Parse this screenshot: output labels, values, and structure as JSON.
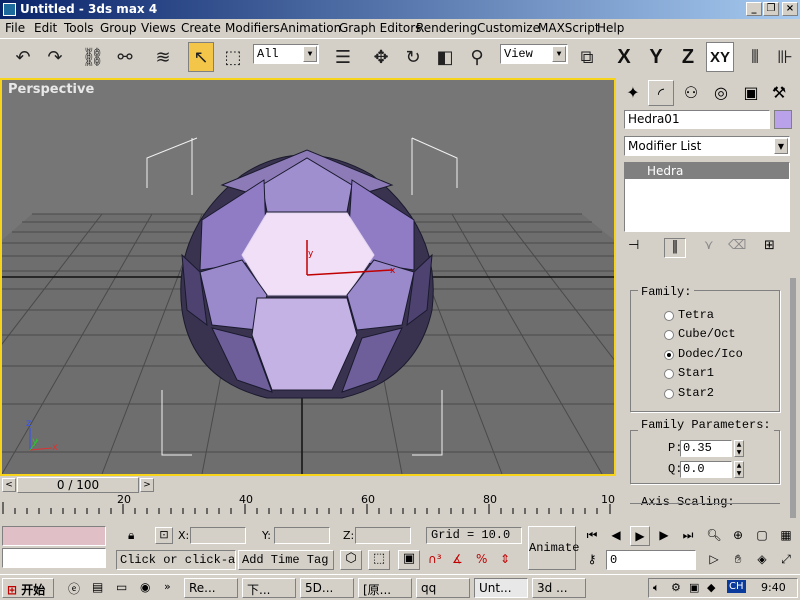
{
  "window": {
    "title": "Untitled - 3ds max 4"
  },
  "menu": [
    "File",
    "Edit",
    "Tools",
    "Group",
    "Views",
    "Create",
    "Modifiers",
    "Animation",
    "Graph Editors",
    "Rendering",
    "Customize",
    "MAXScript",
    "Help"
  ],
  "toolbar": {
    "selection_filter": "All",
    "ref_coord": "View",
    "axis_x": "X",
    "axis_y": "Y",
    "axis_z": "Z",
    "axis_xy": "XY"
  },
  "viewport": {
    "label": "Perspective"
  },
  "time_slider": {
    "value": "0 / 100"
  },
  "timeline": {
    "ticks": [
      "20",
      "40",
      "60",
      "80",
      "10"
    ]
  },
  "command_panel": {
    "object_name": "Hedra01",
    "object_color": "#b9a2ea",
    "modifier_list": "Modifier List",
    "stack_item": "Hedra",
    "family_group": "Family:",
    "families": [
      "Tetra",
      "Cube/Oct",
      "Dodec/Ico",
      "Star1",
      "Star2"
    ],
    "selected_family": "Dodec/Ico",
    "params_group": "Family Parameters:",
    "p_label": "P:",
    "p_value": "0.35",
    "q_label": "Q:",
    "q_value": "0.0",
    "axis_group": "Axis Scaling:"
  },
  "status": {
    "x_label": "X:",
    "y_label": "Y:",
    "z_label": "Z:",
    "grid": "Grid = 10.0",
    "prompt": "Click or click-a",
    "add_time_tag": "Add Time Tag",
    "animate": "Animate",
    "frame": "0"
  },
  "taskbar": {
    "start": "开始",
    "tasks": [
      "Re...",
      "下...",
      "5D...",
      "[原...",
      "qq",
      "Unt...",
      "3d ..."
    ],
    "lang": "CH",
    "clock": "9:40"
  }
}
